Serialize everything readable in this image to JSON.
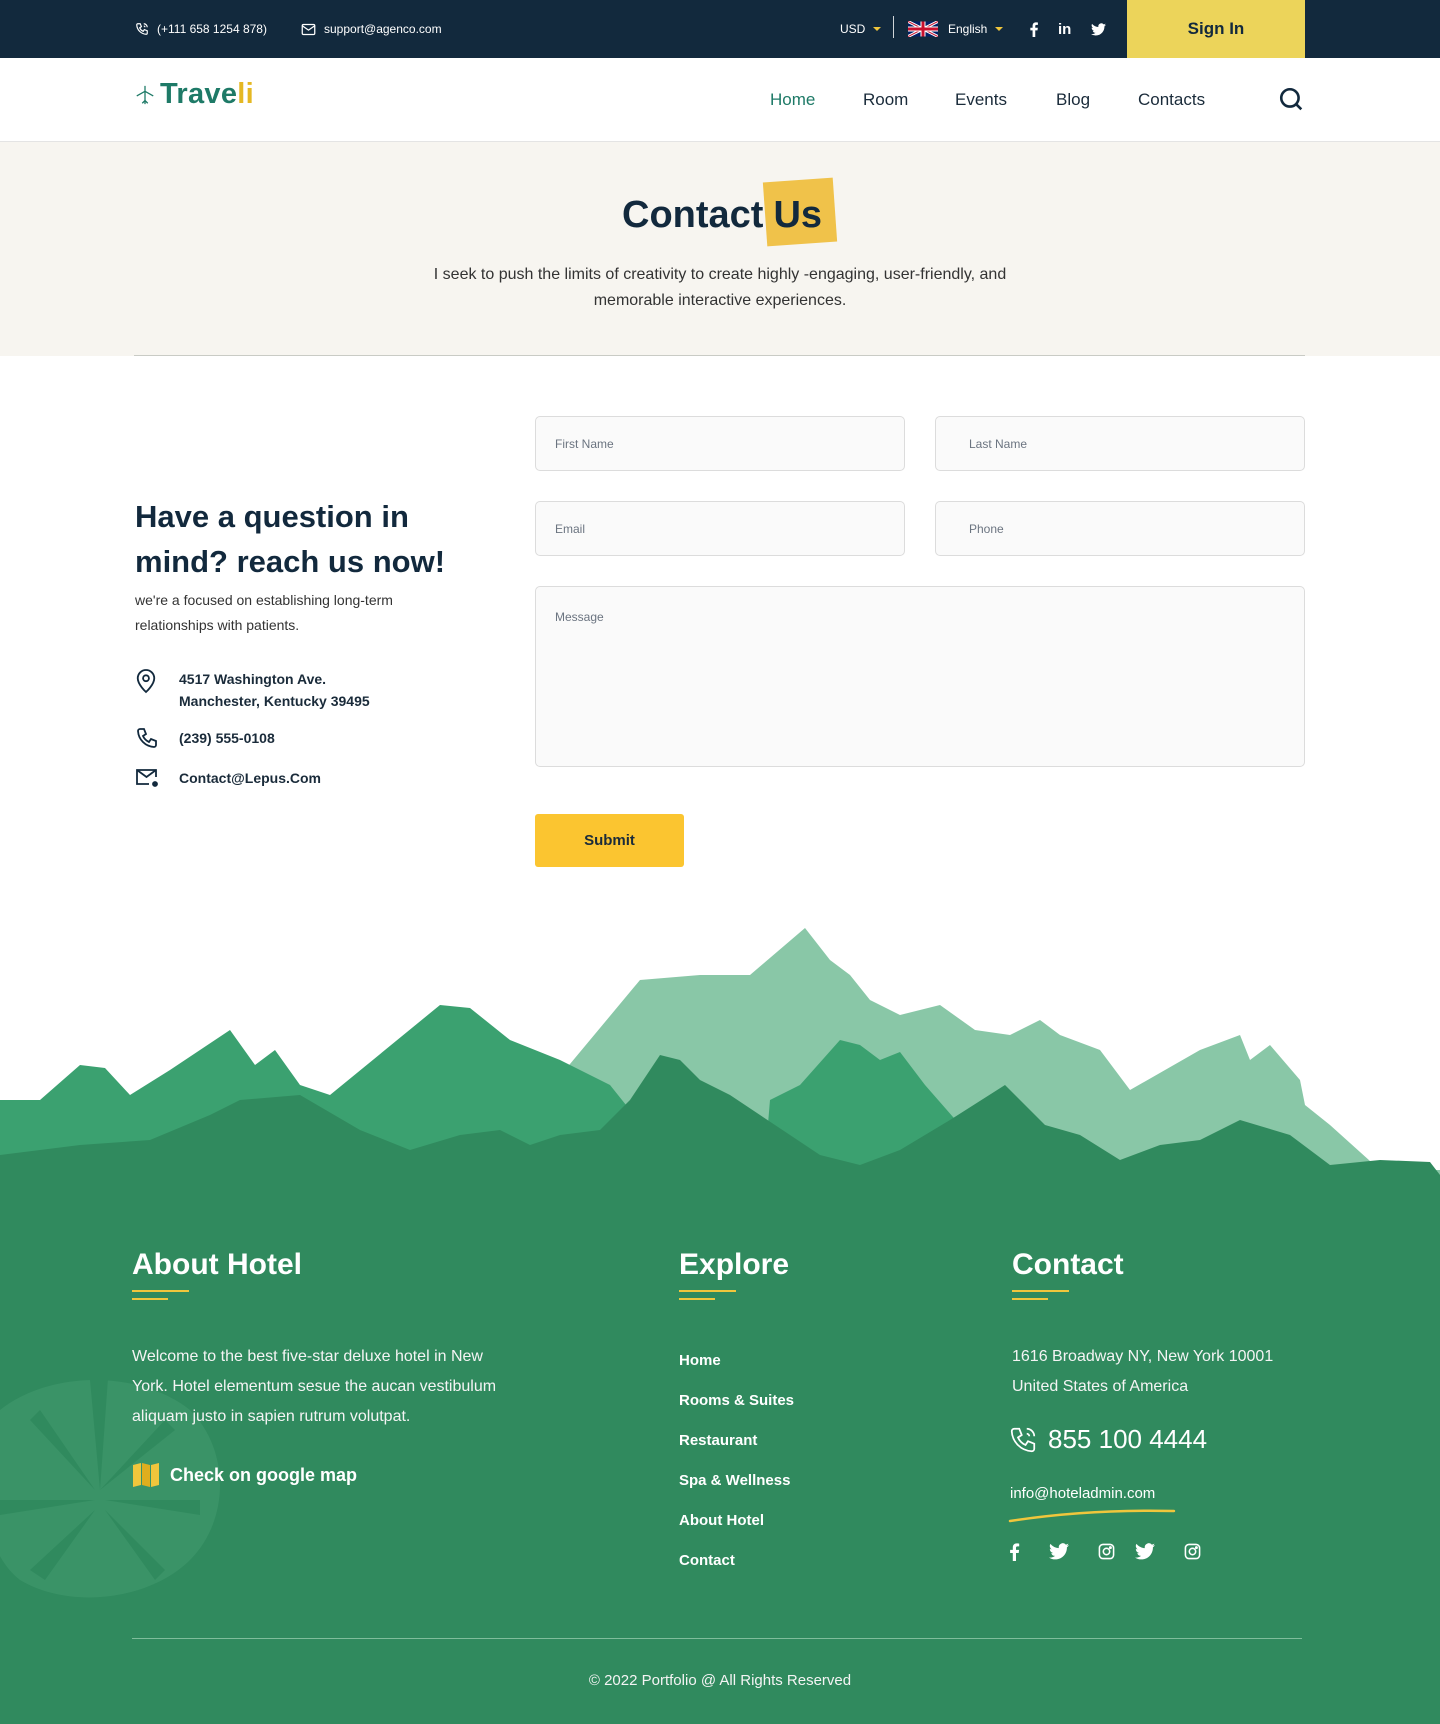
{
  "topbar": {
    "phone": "(+111 658 1254 878)",
    "email": "support@agenco.com",
    "currency": "USD",
    "language": "English",
    "social": [
      "facebook-icon",
      "linkedin-icon",
      "twitter-icon"
    ],
    "linkedin_label": "in",
    "signin_label": "Sign In",
    "colors": {
      "background": "#12293d",
      "signin": "#ecd45a",
      "caret": "#f0c63c"
    }
  },
  "nav": {
    "brand_main": "Trave",
    "brand_accent": "li",
    "items": [
      {
        "label": "Home",
        "active": true
      },
      {
        "label": "Room"
      },
      {
        "label": "Events"
      },
      {
        "label": "Blog"
      },
      {
        "label": "Contacts"
      }
    ],
    "search_icon": "search-icon",
    "colors": {
      "active": "#1e7a67",
      "accent": "#e5b823"
    }
  },
  "hero": {
    "title_main": "Contact",
    "title_highlight": "Us",
    "subtitle": "I seek to push the limits of creativity to create highly -engaging, user-friendly, and memorable interactive experiences."
  },
  "contact": {
    "heading": "Have a question in mind? reach us now!",
    "description": "we're a focused on establishing long-term relationships with patients.",
    "address": "4517 Washington Ave. Manchester, Kentucky 39495",
    "phone": "(239) 555-0108",
    "email": "Contact@Lepus.Com",
    "form": {
      "first_name": "First Name",
      "last_name": "Last Name",
      "email": "Email",
      "phone": "Phone",
      "message": "Message",
      "submit": "Submit"
    }
  },
  "footer": {
    "about": {
      "title": "About Hotel",
      "text": "Welcome to the best five-star deluxe hotel in New York. Hotel elementum sesue the aucan vestibulum aliquam justo in sapien rutrum volutpat.",
      "map_link": "Check on google map"
    },
    "explore": {
      "title": "Explore",
      "items": [
        "Home",
        "Rooms & Suites",
        "Restaurant",
        "Spa & Wellness",
        "About Hotel",
        "Contact"
      ]
    },
    "contact": {
      "title": "Contact",
      "address": "1616 Broadway NY, New York 10001 United States of America",
      "phone": "855 100 4444",
      "email": "info@hoteladmin.com",
      "social": [
        "facebook-icon",
        "twitter-icon",
        "instagram-icon",
        "twitter-icon",
        "instagram-icon"
      ]
    },
    "copyright": "© 2022 Portfolio @ All Rights Reserved",
    "colors": {
      "background": "#308a5e",
      "underline": "#f0c63c"
    }
  }
}
